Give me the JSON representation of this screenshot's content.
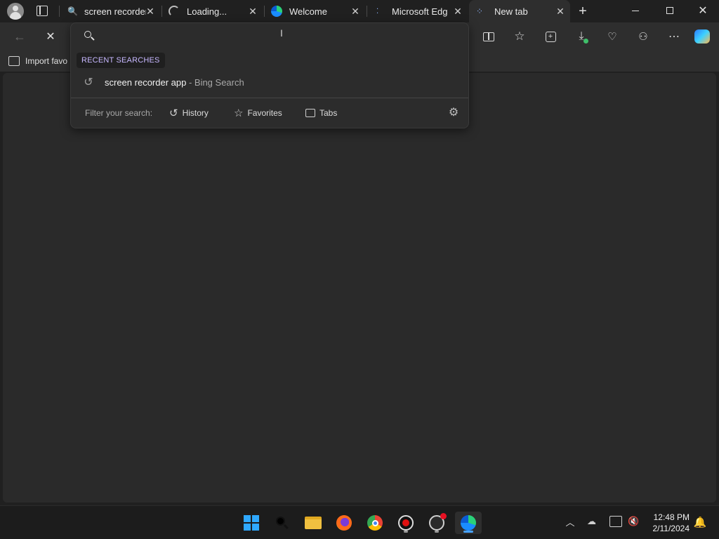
{
  "tabs": [
    {
      "title": "screen recorder"
    },
    {
      "title": "Loading..."
    },
    {
      "title": "Welcome"
    },
    {
      "title": "Microsoft Edge"
    },
    {
      "title": "New tab"
    }
  ],
  "favorites_bar": {
    "import_label": "Import favo"
  },
  "omnibox": {
    "recent_heading": "RECENT SEARCHES",
    "suggestion_query": "screen recorder app",
    "suggestion_source": " - Bing Search",
    "filter_label": "Filter your search:",
    "filters": {
      "history": "History",
      "favorites": "Favorites",
      "tabs": "Tabs"
    }
  },
  "taskbar": {
    "time": "12:48 PM",
    "date": "2/11/2024"
  },
  "colors": {
    "accent": "#c7b8ff",
    "edge_blue": "#1a8cff"
  }
}
